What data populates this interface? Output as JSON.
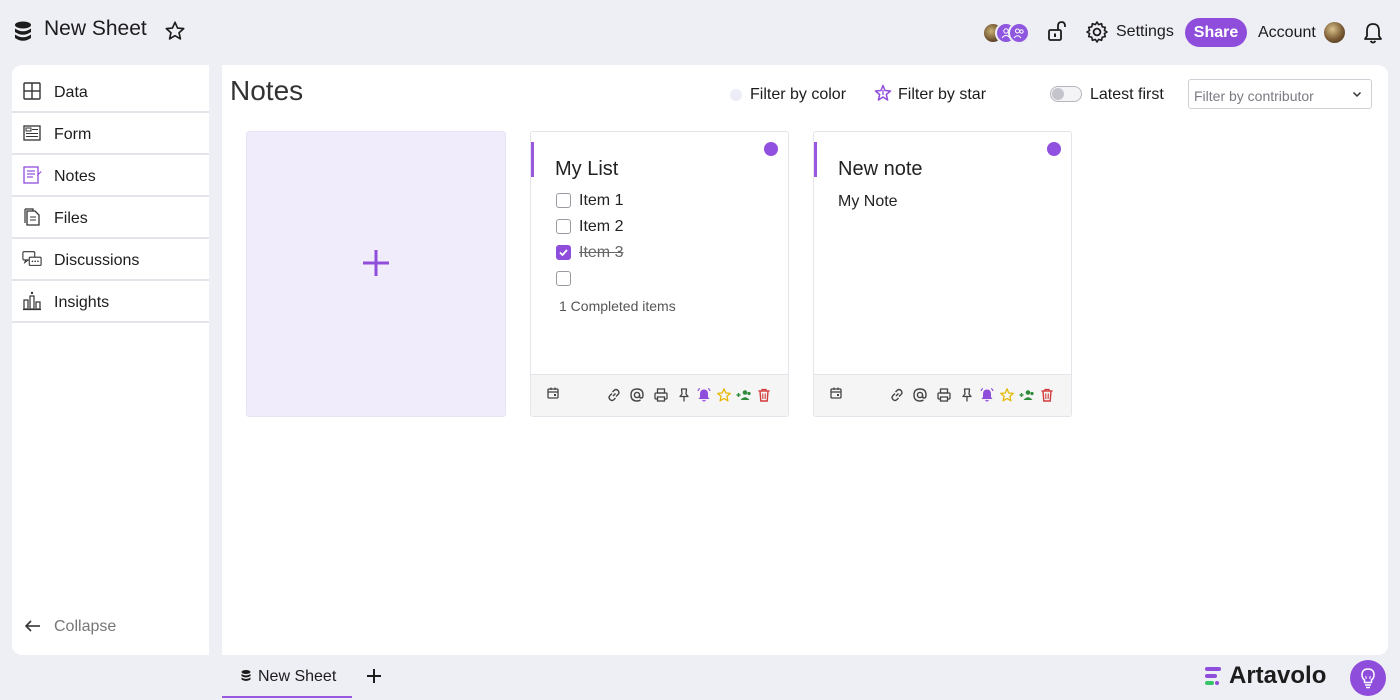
{
  "header": {
    "sheet_title": "New Sheet",
    "settings_label": "Settings",
    "share_label": "Share",
    "account_label": "Account"
  },
  "sidebar": {
    "items": [
      {
        "label": "Data",
        "icon": "table-icon"
      },
      {
        "label": "Form",
        "icon": "form-icon"
      },
      {
        "label": "Notes",
        "icon": "notes-icon"
      },
      {
        "label": "Files",
        "icon": "files-icon"
      },
      {
        "label": "Discussions",
        "icon": "discussions-icon"
      },
      {
        "label": "Insights",
        "icon": "insights-icon"
      }
    ],
    "collapse_label": "Collapse"
  },
  "main": {
    "title": "Notes",
    "filter_color_label": "Filter by color",
    "filter_star_label": "Filter by star",
    "latest_first_label": "Latest first",
    "latest_first_on": false,
    "contributor_placeholder": "Filter by contributor"
  },
  "cards": [
    {
      "title": "My List",
      "items": [
        {
          "label": "Item 1",
          "checked": false
        },
        {
          "label": "Item 2",
          "checked": false
        },
        {
          "label": "Item 3",
          "checked": true
        },
        {
          "label": "",
          "checked": false
        }
      ],
      "completed_text": "1 Completed items"
    },
    {
      "title": "New note",
      "body": "My Note"
    }
  ],
  "footer_icons": [
    "calendar-icon",
    "link-icon",
    "mention-icon",
    "print-icon",
    "pin-icon",
    "reminder-bell-icon",
    "star-icon",
    "share-users-icon",
    "trash-icon"
  ],
  "bottom": {
    "tab_label": "New Sheet",
    "brand_name": "Artavolo"
  },
  "colors": {
    "accent": "#8f4ddb",
    "add_card_bg": "#f1ecfb",
    "star_yellow": "#e6b800",
    "share_green": "#2e8b3a",
    "trash_red": "#d33a3a"
  }
}
